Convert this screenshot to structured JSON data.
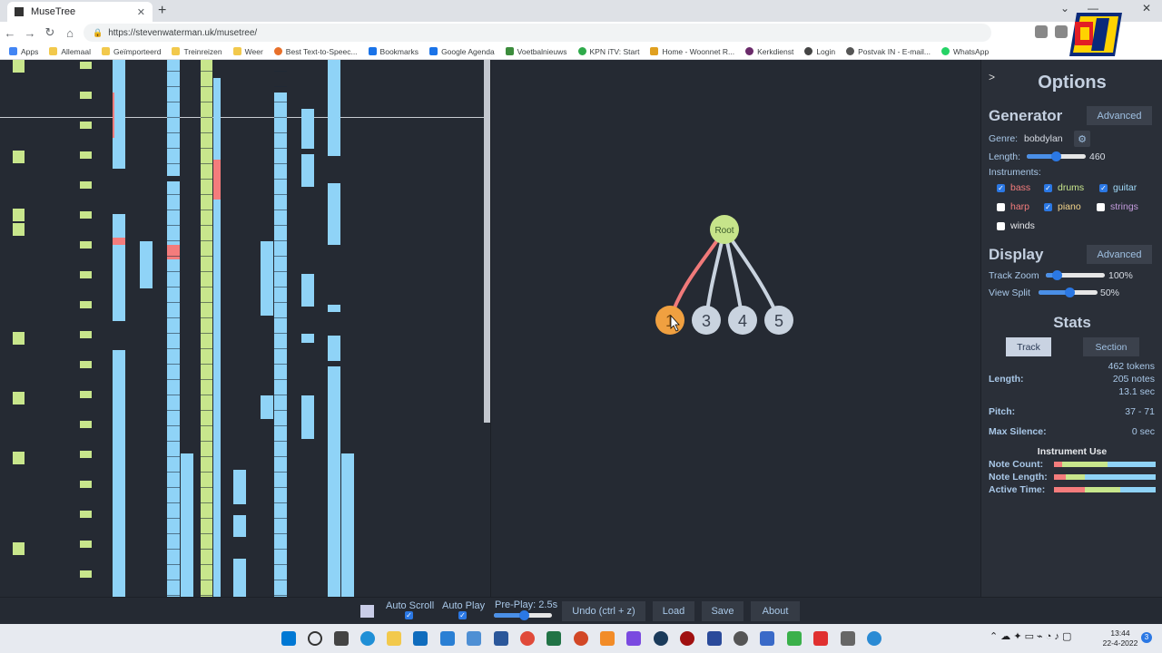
{
  "browser": {
    "tab_title": "MuseTree",
    "tab_close": "✕",
    "new_tab": "+",
    "url": "https://stevenwaterman.uk/musetree/",
    "bookmarks": [
      "Apps",
      "Allemaal",
      "Geïmporteerd",
      "Treinreizen",
      "Weer",
      "Best Text-to-Speec...",
      "Bookmarks",
      "Google Agenda",
      "Voetbalnieuws",
      "KPN iTV: Start",
      "Home - Woonnet R...",
      "Kerkdienst",
      "Login",
      "Postvak IN - E-mail...",
      "WhatsApp"
    ],
    "bookmarks_right": "bookmarks"
  },
  "tree": {
    "root_label": "Root",
    "children": [
      "1",
      "3",
      "4",
      "5"
    ]
  },
  "options": {
    "toggle": ">",
    "title": "Options",
    "generator": {
      "title": "Generator",
      "advanced": "Advanced",
      "genre_label": "Genre:",
      "genre_value": "bobdylan",
      "length_label": "Length:",
      "length_value": "460",
      "length_fraction": 0.5,
      "instruments_label": "Instruments:",
      "instruments": [
        {
          "name": "bass",
          "checked": true,
          "color": "#f47c7c"
        },
        {
          "name": "drums",
          "checked": true,
          "color": "#c8e68c"
        },
        {
          "name": "guitar",
          "checked": true,
          "color": "#9fd8f7"
        },
        {
          "name": "harp",
          "checked": false,
          "color": "#f47c7c"
        },
        {
          "name": "piano",
          "checked": true,
          "color": "#f5d48a"
        },
        {
          "name": "strings",
          "checked": false,
          "color": "#c39bdc"
        },
        {
          "name": "winds",
          "checked": false,
          "color": "#e8eaed"
        }
      ]
    },
    "display": {
      "title": "Display",
      "advanced": "Advanced",
      "track_zoom_label": "Track Zoom",
      "track_zoom_value": "100%",
      "view_split_label": "View Split",
      "view_split_value": "50%"
    },
    "stats": {
      "title": "Stats",
      "track_btn": "Track",
      "section_btn": "Section",
      "tokens": "462 tokens",
      "length_label": "Length:",
      "notes": "205 notes",
      "seconds": "13.1 sec",
      "pitch_label": "Pitch:",
      "pitch_value": "37 - 71",
      "silence_label": "Max Silence:",
      "silence_value": "0 sec",
      "instrument_use_title": "Instrument Use",
      "note_count_label": "Note Count:",
      "note_length_label": "Note Length:",
      "active_time_label": "Active Time:",
      "note_count": [
        0.08,
        0.45,
        0.47
      ],
      "note_length": [
        0.12,
        0.18,
        0.7
      ],
      "active_time": [
        0.3,
        0.35,
        0.35
      ]
    }
  },
  "bottom": {
    "auto_scroll": "Auto Scroll",
    "auto_play": "Auto Play",
    "pre_play": "Pre-Play: 2.5s",
    "undo": "Undo (ctrl + z)",
    "load": "Load",
    "save": "Save",
    "about": "About"
  },
  "taskbar": {
    "time": "13:44",
    "date": "22-4-2022",
    "notifications": "3"
  },
  "colors": {
    "bass": "#f47c7c",
    "drums": "#c8e68c",
    "guitar": "#8fd3f7",
    "tree_node": "#c9d3df",
    "tree_selected": "#f0a040",
    "root": "#c6e48a"
  }
}
